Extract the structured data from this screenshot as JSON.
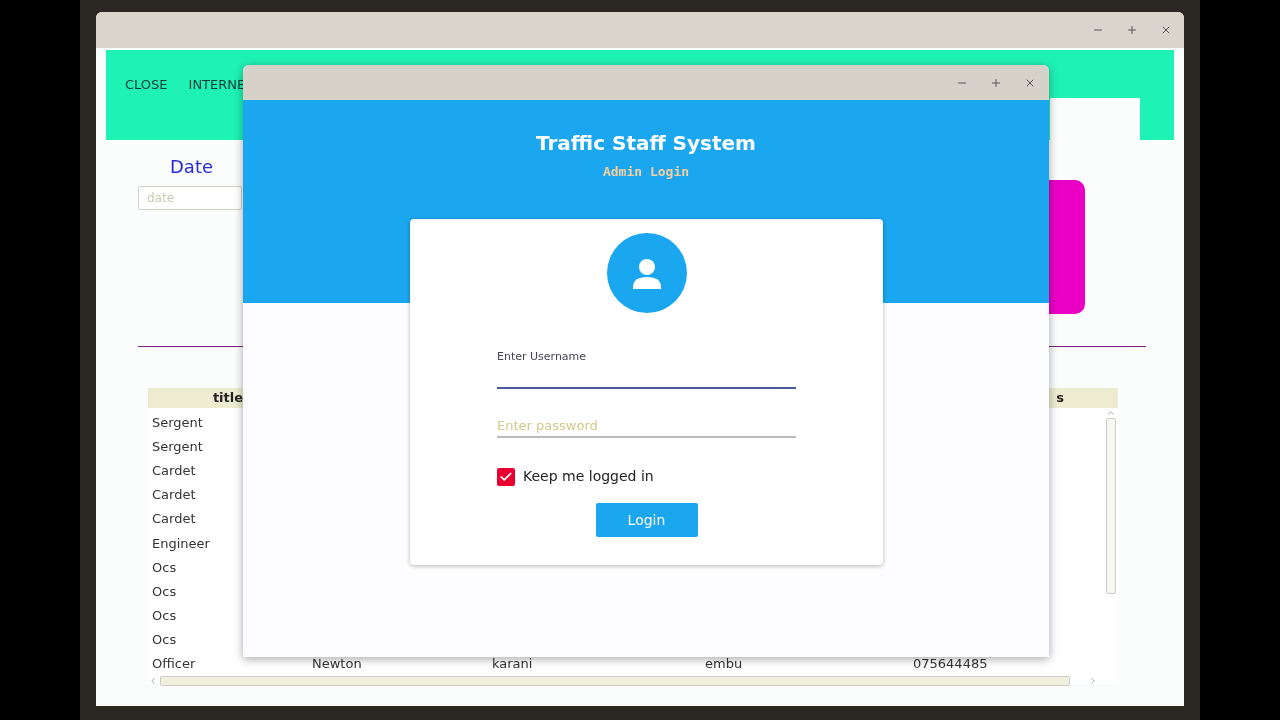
{
  "main_window": {
    "menu": [
      "CLOSE",
      "INTERNE"
    ],
    "date": {
      "label": "Date",
      "placeholder": "date"
    },
    "table": {
      "header": {
        "column_1": "title",
        "column_5": "s"
      },
      "rows": [
        [
          "Sergent"
        ],
        [
          "Sergent"
        ],
        [
          "Cardet"
        ],
        [
          "Cardet"
        ],
        [
          "Cardet"
        ],
        [
          "Engineer"
        ],
        [
          "Ocs"
        ],
        [
          "Ocs"
        ],
        [
          "Ocs"
        ],
        [
          "Ocs"
        ],
        [
          "Officer",
          "Newton",
          "karani",
          "embu",
          "075644485"
        ]
      ]
    }
  },
  "login_window": {
    "title": "Traffic Staff System",
    "subtitle": "Admin Login",
    "username": {
      "label": "Enter Username",
      "focused": true
    },
    "password": {
      "placeholder": "Enter password",
      "focused": false
    },
    "remember": {
      "label": "Keep me logged in",
      "checked": true
    },
    "button": "Login"
  }
}
